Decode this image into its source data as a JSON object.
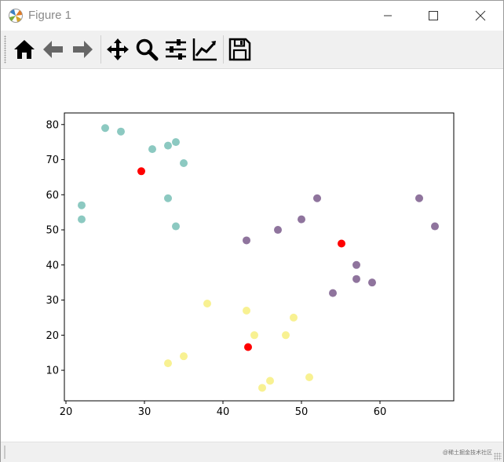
{
  "window": {
    "title": "Figure 1"
  },
  "toolbar": {
    "tools": [
      "home-icon",
      "back-arrow-icon",
      "forward-arrow-icon",
      "pan-icon",
      "zoom-icon",
      "subplots-config-icon",
      "edit-axes-icon",
      "save-icon"
    ]
  },
  "status": {
    "watermark": "@稀土掘金技术社区"
  },
  "chart_data": {
    "type": "scatter",
    "title": "",
    "xlabel": "",
    "ylabel": "",
    "xlim": [
      19.8,
      69.4
    ],
    "ylim": [
      1.3,
      83.3
    ],
    "xticks": [
      20,
      30,
      40,
      50,
      60
    ],
    "yticks": [
      10,
      20,
      30,
      40,
      50,
      60,
      70,
      80
    ],
    "grid": false,
    "series": [
      {
        "color": "#3fa598",
        "alpha": 0.6,
        "points": [
          [
            25,
            79
          ],
          [
            27,
            78
          ],
          [
            31,
            73
          ],
          [
            33,
            74
          ],
          [
            34,
            75
          ],
          [
            35,
            69
          ],
          [
            22,
            57
          ],
          [
            22,
            53
          ],
          [
            33,
            59
          ],
          [
            34,
            51
          ]
        ]
      },
      {
        "color": "#45185c",
        "alpha": 0.6,
        "points": [
          [
            43,
            47
          ],
          [
            47,
            50
          ],
          [
            50,
            53
          ],
          [
            52,
            59
          ],
          [
            65,
            59
          ],
          [
            67,
            51
          ],
          [
            57,
            40
          ],
          [
            57,
            36
          ],
          [
            59,
            35
          ],
          [
            54,
            32
          ]
        ]
      },
      {
        "color": "#f3e84a",
        "alpha": 0.6,
        "points": [
          [
            38,
            29
          ],
          [
            43,
            27
          ],
          [
            44,
            20
          ],
          [
            48,
            20
          ],
          [
            49,
            25
          ],
          [
            33,
            12
          ],
          [
            35,
            14
          ],
          [
            45,
            5
          ],
          [
            46,
            7
          ],
          [
            51,
            8
          ]
        ]
      },
      {
        "color": "#ff0000",
        "alpha": 1,
        "points": [
          [
            29.6,
            66.7
          ],
          [
            55.1,
            46.1
          ],
          [
            43.2,
            16.6
          ]
        ]
      }
    ]
  }
}
